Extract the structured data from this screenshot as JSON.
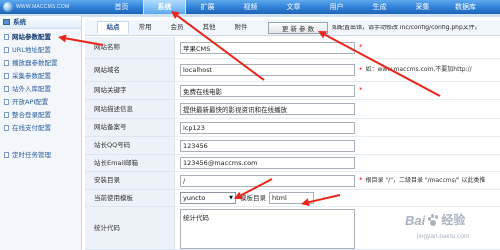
{
  "header": {
    "logo_text": "WWW.MACCMS.COM",
    "tabs": [
      "首页",
      "系统",
      "扩展",
      "视频",
      "文章",
      "用户",
      "生成",
      "采集",
      "数据库"
    ],
    "active_tab_index": 1
  },
  "sidebar": {
    "title": "系统",
    "items": [
      "网站参数配置",
      "URL地址配置",
      "播放器参数配置",
      "采集参数配置",
      "站外入库配置",
      "开放API配置",
      "整合登录配置",
      "在线支付配置",
      "定时任务管理"
    ],
    "selected_item_index": 0
  },
  "settings": {
    "subtabs": [
      "站点",
      "常用",
      "会员",
      "其他",
      "附件"
    ],
    "active_subtab_index": 0,
    "update_button_label": "更 新 参 数",
    "update_hint": "如配置出错，请手动修改 inc/config/config.php文件。"
  },
  "form": {
    "site_name": {
      "label": "网站名称",
      "value": "苹果CMS",
      "required_mark": "*"
    },
    "site_domain": {
      "label": "网站域名",
      "value": "localhost",
      "required_mark": "*",
      "hint": "如：www.maccms.com,不要加http://"
    },
    "site_keywords": {
      "label": "网站关键字",
      "value": "免费在线电影",
      "required_mark": "*"
    },
    "site_description": {
      "label": "网站描述信息",
      "value": "提供最新最快的影视资讯和在线播放"
    },
    "icp_number": {
      "label": "网站备案号",
      "value": "icp123"
    },
    "admin_qq": {
      "label": "站长QQ号码",
      "value": "123456"
    },
    "admin_email": {
      "label": "站长Email邮箱",
      "value": "123456@maccms.com"
    },
    "install_dir": {
      "label": "安装目录",
      "value": "/",
      "required_mark": "*",
      "hint": "根目录 \"/\"，二级目录 \"/maccms/\" 以此类推"
    },
    "template": {
      "label": "当前使用模板",
      "value": "yuncto",
      "dir_label": "模板目录",
      "dir_value": "html"
    },
    "stats_code": {
      "label": "统计代码",
      "value": "统计代码"
    }
  },
  "watermark": {
    "brand_left": "Bai",
    "brand_right": "经验",
    "url": "jingyan.baidu.com"
  },
  "colors": {
    "nav_blue": "#2f7fd6",
    "annotation_red": "#e8261c",
    "required_red": "#ff0000",
    "sidebar_text": "#2a5d9e"
  }
}
